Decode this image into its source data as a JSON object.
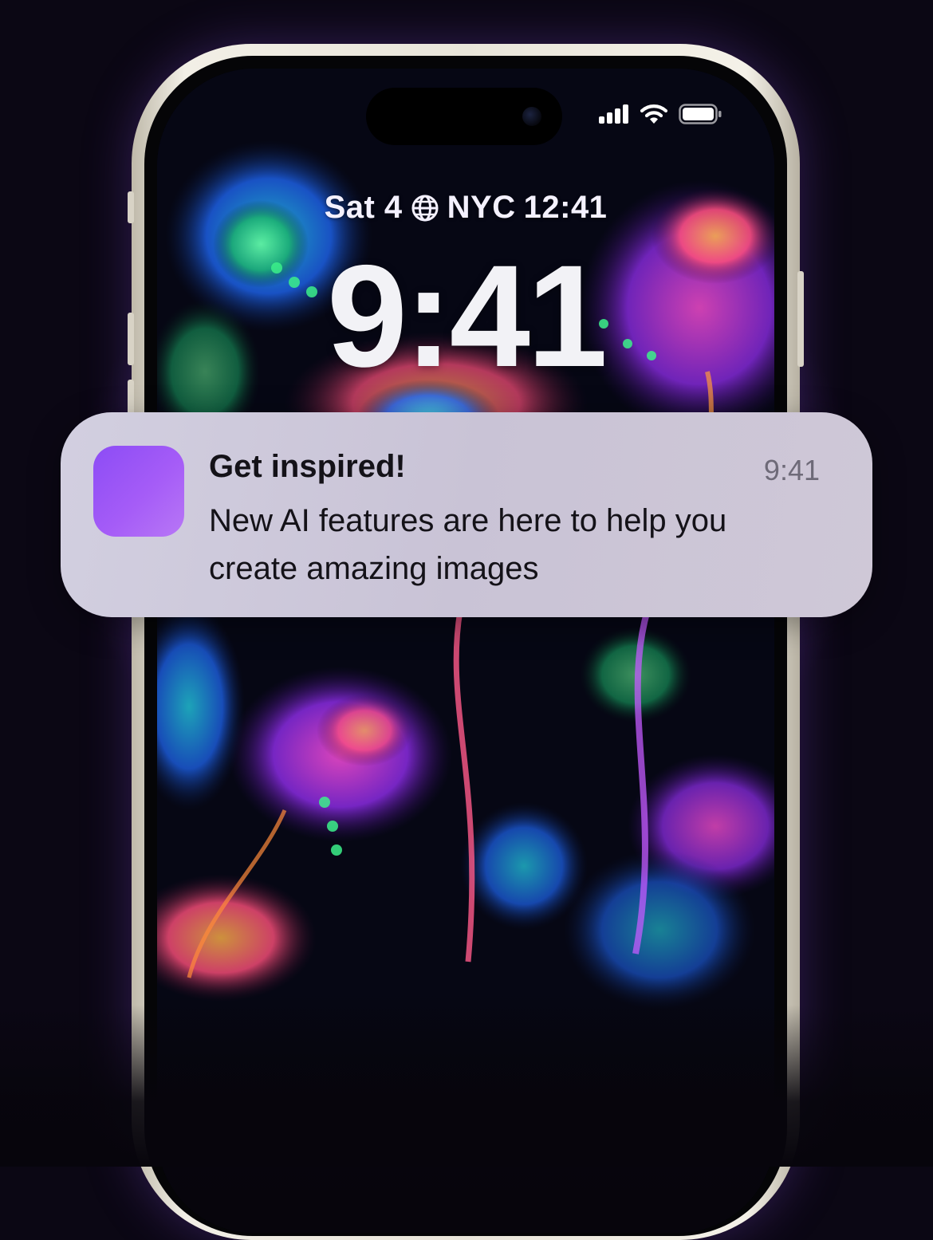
{
  "lock_screen": {
    "date_weekday": "Sat 4",
    "world_clock_city": "NYC",
    "world_clock_time": "12:41",
    "clock": "9:41",
    "status_icons": [
      "cellular-signal-icon",
      "wifi-icon",
      "battery-icon"
    ]
  },
  "notification": {
    "title": "Get inspired!",
    "time": "9:41",
    "body_lines": [
      "New AI features are here to help you",
      "create amazing images"
    ],
    "app_icon_color": "#a05cf7"
  },
  "colors": {
    "background_glow": "#4a2a78",
    "phone_frame": "#efece3",
    "notification_bg": "#ccc7d9"
  }
}
